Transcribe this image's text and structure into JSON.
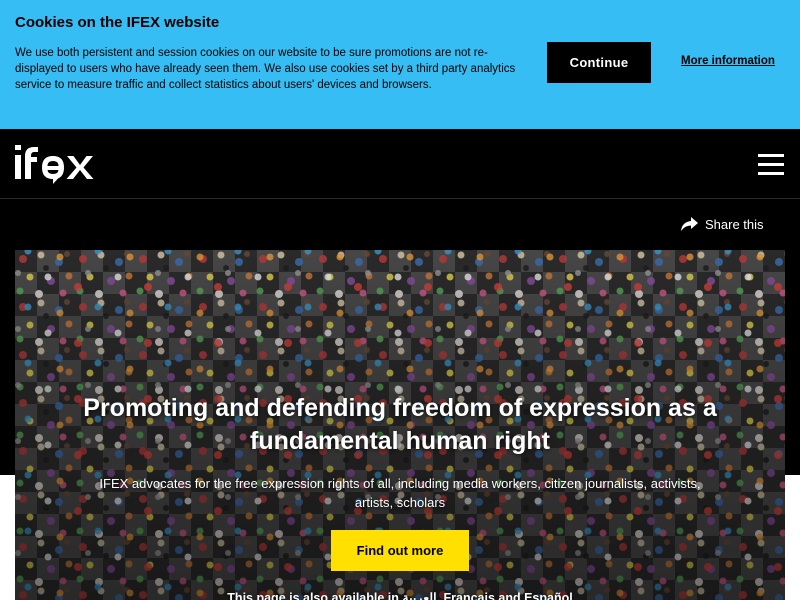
{
  "cookie_banner": {
    "title": "Cookies on the IFEX website",
    "text": "We use both persistent and session cookies on our website to be sure promotions are not re-displayed to users who have already seen them. We also use cookies set by a third party analytics service to measure traffic and collect statistics about users' devices and browsers.",
    "continue_label": "Continue",
    "more_info_label": "More information",
    "background_color": "#36bdf3"
  },
  "header": {
    "logo_text": "ifex",
    "menu_icon": "hamburger-menu-icon"
  },
  "share": {
    "label": "Share this",
    "icon": "share-arrow-icon"
  },
  "hero": {
    "title": "Promoting and defending freedom of expression as a fundamental human right",
    "subtitle": "IFEX advocates for the free expression rights of all, including media workers, citizen journalists, activists, artists, scholars",
    "cta_label": "Find out more",
    "cta_color": "#ffe000",
    "language_note": "This page is also available in ﺍﻟﻌﺮﺑﻴﺔ, Français and Español"
  }
}
